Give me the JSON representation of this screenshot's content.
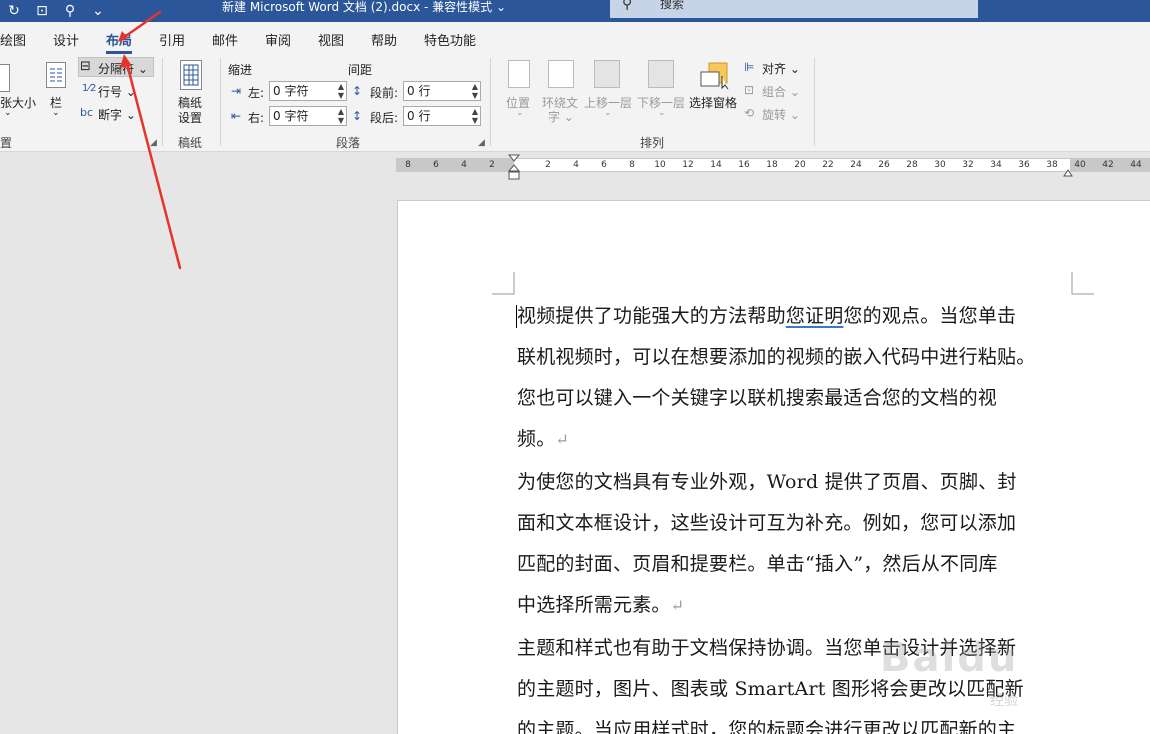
{
  "window": {
    "title": "新建 Microsoft Word 文档 (2).docx  -  兼容性模式 ⌄",
    "search_placeholder": "搜索",
    "qat": [
      "↻",
      "⊡",
      "⚲",
      "⌄"
    ]
  },
  "tabs": [
    {
      "label": "绘图"
    },
    {
      "label": "设计"
    },
    {
      "label": "布局"
    },
    {
      "label": "引用"
    },
    {
      "label": "邮件"
    },
    {
      "label": "审阅"
    },
    {
      "label": "视图"
    },
    {
      "label": "帮助"
    },
    {
      "label": "特色功能"
    }
  ],
  "ribbon": {
    "page_setup": {
      "size_label": "张大小",
      "columns_label": "栏",
      "breaks_label": "分隔符 ⌄",
      "line_numbers_label": "行号 ⌄",
      "hyphenation_label": "断字 ⌄",
      "group_label": "置"
    },
    "draft": {
      "button_label_1": "稿纸",
      "button_label_2": "设置",
      "group_label": "稿纸"
    },
    "paragraph": {
      "indent_title": "缩进",
      "spacing_title": "间距",
      "left_label": "左:",
      "right_label": "右:",
      "before_label": "段前:",
      "after_label": "段后:",
      "left_value": "0 字符",
      "right_value": "0 字符",
      "before_value": "0 行",
      "after_value": "0 行",
      "group_label": "段落"
    },
    "arrange": {
      "position_label": "位置",
      "wrap_label_1": "环绕文",
      "wrap_label_2": "字 ⌄",
      "forward_label": "上移一层",
      "backward_label": "下移一层",
      "selection_pane_label": "选择窗格",
      "align_label": "对齐 ⌄",
      "group_objects_label": "组合 ⌄",
      "rotate_label": "旋转 ⌄",
      "group_label": "排列"
    }
  },
  "ruler": {
    "left_ticks": [
      "8",
      "6",
      "4",
      "2"
    ],
    "right_ticks": [
      "2",
      "4",
      "6",
      "8",
      "10",
      "12",
      "14",
      "16",
      "18",
      "20",
      "22",
      "24",
      "26",
      "28",
      "30",
      "32",
      "34",
      "36",
      "38",
      "40",
      "42",
      "44"
    ]
  },
  "document": {
    "paragraphs": [
      {
        "lines": [
          [
            "视频提供了功能强大的方法帮助",
            "您证明",
            "您的观点。当您单击"
          ],
          [
            "联机视频时，可以在想要添加的视频的嵌入代码中进行粘贴。"
          ],
          [
            "您也可以键入一个关键字以联机搜索最适合您的文档的视"
          ],
          [
            "频。"
          ]
        ]
      },
      {
        "lines": [
          [
            "为使您的文档具有专业外观，Word 提供了页眉、页脚、封"
          ],
          [
            "面和文本框设计，这些设计可互为补充。例如，您可以添加"
          ],
          [
            "匹配的封面、页眉和提要栏。单击“插入”，然后从不同库"
          ],
          [
            "中选择所需元素。"
          ]
        ]
      },
      {
        "lines": [
          [
            "主题和样式也有助于文档保持协调。当您单击设计并选择新"
          ],
          [
            "的主题时，图片、图表或 SmartArt 图形将会更改以匹配新"
          ],
          [
            "的主题。当应用样式时，您的标题会进行更改以匹配新的主"
          ]
        ]
      }
    ],
    "paragraph_mark": "↵"
  },
  "watermark": {
    "logo": "Baidu",
    "sub": "经验"
  },
  "colors": {
    "title_bar": "#2b579a",
    "annotation": "#e8322a",
    "ribbon_bg": "#f3f3f3"
  }
}
